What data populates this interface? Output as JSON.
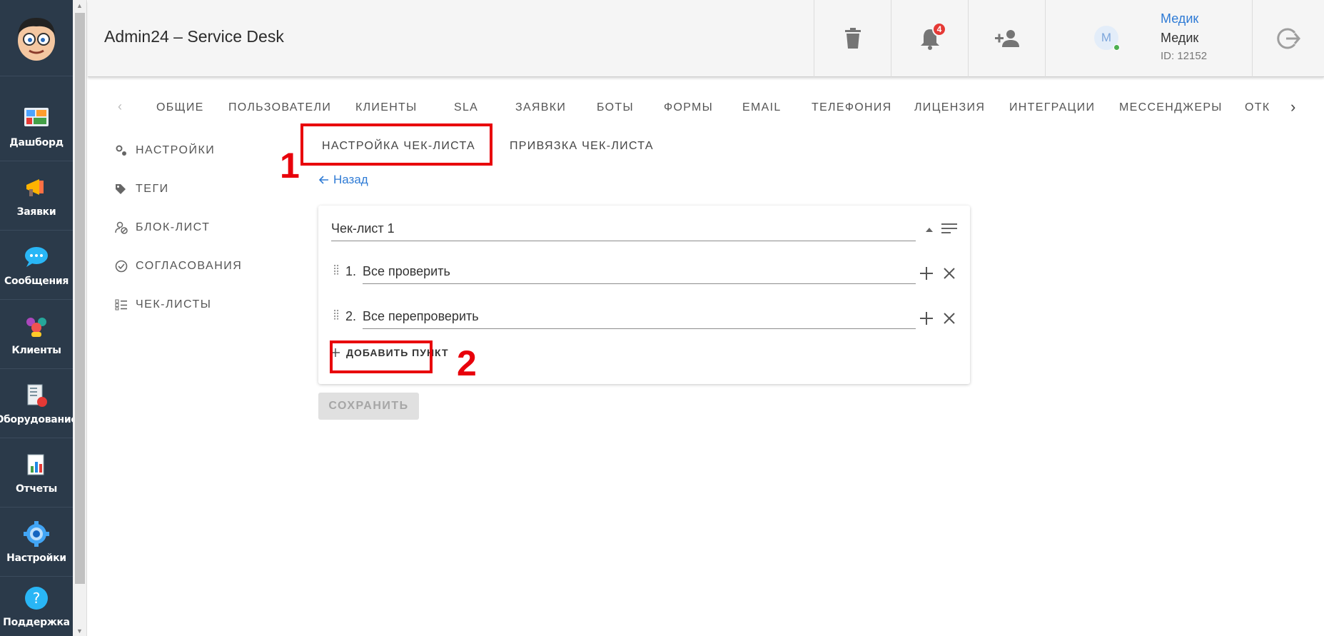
{
  "header": {
    "title": "Admin24 – Service Desk",
    "notifications_count": "4",
    "user": {
      "avatar_letter": "M",
      "link": "Медик",
      "name": "Медик",
      "id_text": "ID: 12152"
    }
  },
  "sidebar": {
    "items": [
      {
        "label": "Дашборд",
        "icon": "dashboard-icon"
      },
      {
        "label": "Заявки",
        "icon": "megaphone-icon"
      },
      {
        "label": "Сообщения",
        "icon": "chat-icon"
      },
      {
        "label": "Клиенты",
        "icon": "clients-icon"
      },
      {
        "label": "Оборудование",
        "icon": "equipment-icon"
      },
      {
        "label": "Отчеты",
        "icon": "reports-icon"
      },
      {
        "label": "Настройки",
        "icon": "gear-icon"
      },
      {
        "label": "Поддержка",
        "icon": "help-icon"
      }
    ]
  },
  "tabs": [
    "ОБЩИЕ",
    "ПОЛЬЗОВАТЕЛИ",
    "КЛИЕНТЫ",
    "SLA",
    "ЗАЯВКИ",
    "БОТЫ",
    "ФОРМЫ",
    "EMAIL",
    "ТЕЛЕФОНИЯ",
    "ЛИЦЕНЗИЯ",
    "ИНТЕГРАЦИИ",
    "МЕССЕНДЖЕРЫ",
    "ОТКР"
  ],
  "side_menu": [
    "НАСТРОЙКИ",
    "ТЕГИ",
    "БЛОК-ЛИСТ",
    "СОГЛАСОВАНИЯ",
    "ЧЕК-ЛИСТЫ"
  ],
  "subtabs": {
    "setup": "НАСТРОЙКА ЧЕК-ЛИСТА",
    "binding": "ПРИВЯЗКА ЧЕК-ЛИСТА"
  },
  "annotations": {
    "one": "1",
    "two": "2"
  },
  "back_label": "Назад",
  "checklist": {
    "name": "Чек-лист 1",
    "items": [
      {
        "num": "1.",
        "text": "Все проверить"
      },
      {
        "num": "2.",
        "text": "Все перепроверить"
      }
    ],
    "add_label": "ДОБАВИТЬ ПУНКТ"
  },
  "save_label": "СОХРАНИТЬ",
  "colors": {
    "sidebar": "#2b3a4a",
    "accent": "#2f7bd5",
    "annotation": "#e8000b"
  }
}
